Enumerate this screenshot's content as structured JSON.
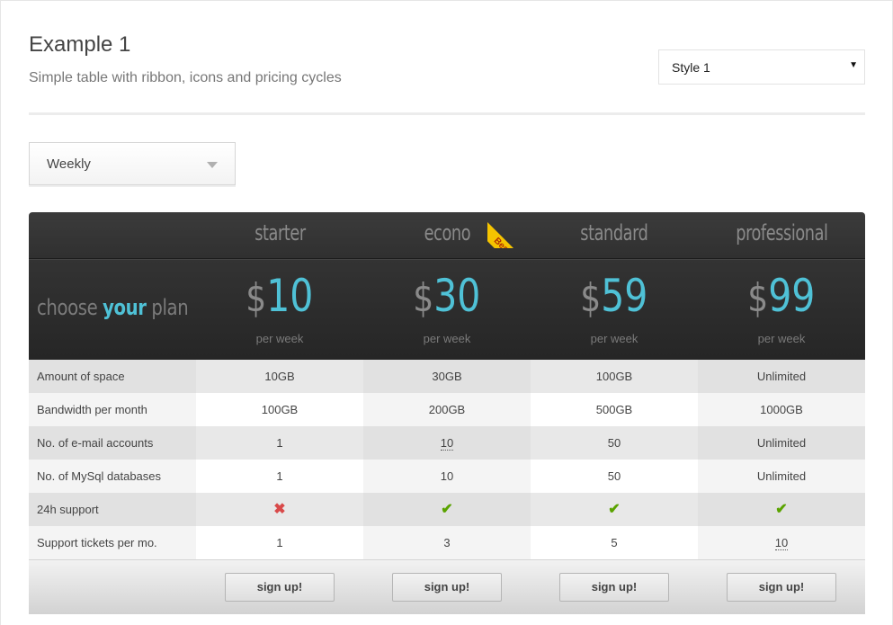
{
  "header": {
    "title": "Example 1",
    "subtitle": "Simple table with ribbon, icons and pricing cycles"
  },
  "style_select": {
    "value": "Style 1"
  },
  "cycle_select": {
    "value": "Weekly"
  },
  "table": {
    "tagline": {
      "pre": "choose ",
      "accent": "your",
      "post": " plan"
    },
    "ribbon_text": "Best!",
    "accent_color": "#4fc1d6",
    "plans": [
      {
        "name": "starter",
        "currency": "$",
        "price": "10",
        "period": "per week",
        "button": "sign up!"
      },
      {
        "name": "econo",
        "currency": "$",
        "price": "30",
        "period": "per week",
        "button": "sign up!"
      },
      {
        "name": "standard",
        "currency": "$",
        "price": "59",
        "period": "per week",
        "button": "sign up!"
      },
      {
        "name": "professional",
        "currency": "$",
        "price": "99",
        "period": "per week",
        "button": "sign up!"
      }
    ],
    "features": [
      {
        "label": "Amount of space",
        "values": [
          "10GB",
          "30GB",
          "100GB",
          "Unlimited"
        ]
      },
      {
        "label": "Bandwidth per month",
        "values": [
          "100GB",
          "200GB",
          "500GB",
          "1000GB"
        ]
      },
      {
        "label": "No. of e-mail accounts",
        "values": [
          "1",
          "10",
          "50",
          "Unlimited"
        ]
      },
      {
        "label": "No. of MySql databases",
        "values": [
          "1",
          "10",
          "50",
          "Unlimited"
        ]
      },
      {
        "label": "24h support",
        "values": [
          "cross-icon",
          "check-icon",
          "check-icon",
          "check-icon"
        ]
      },
      {
        "label": "Support tickets per mo.",
        "values": [
          "1",
          "3",
          "5",
          "10"
        ]
      }
    ]
  }
}
